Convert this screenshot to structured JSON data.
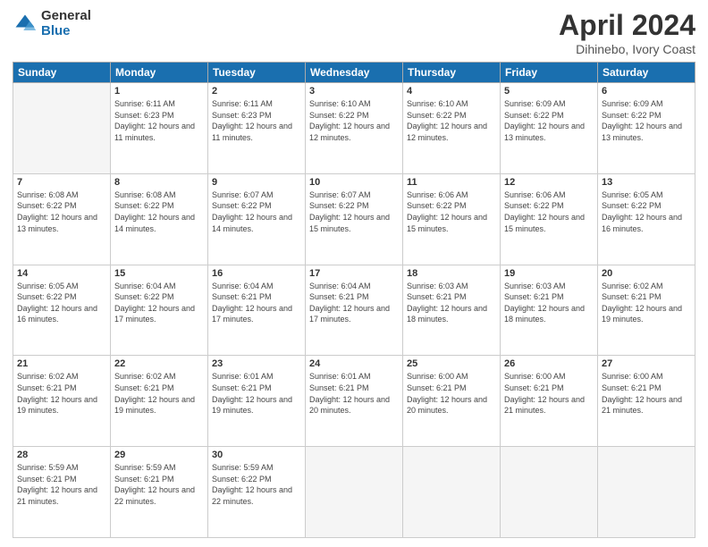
{
  "header": {
    "logo_general": "General",
    "logo_blue": "Blue",
    "title": "April 2024",
    "location": "Dihinebo, Ivory Coast"
  },
  "weekdays": [
    "Sunday",
    "Monday",
    "Tuesday",
    "Wednesday",
    "Thursday",
    "Friday",
    "Saturday"
  ],
  "weeks": [
    [
      {
        "day": "",
        "sunrise": "",
        "sunset": "",
        "daylight": "",
        "empty": true
      },
      {
        "day": "1",
        "sunrise": "Sunrise: 6:11 AM",
        "sunset": "Sunset: 6:23 PM",
        "daylight": "Daylight: 12 hours and 11 minutes."
      },
      {
        "day": "2",
        "sunrise": "Sunrise: 6:11 AM",
        "sunset": "Sunset: 6:23 PM",
        "daylight": "Daylight: 12 hours and 11 minutes."
      },
      {
        "day": "3",
        "sunrise": "Sunrise: 6:10 AM",
        "sunset": "Sunset: 6:22 PM",
        "daylight": "Daylight: 12 hours and 12 minutes."
      },
      {
        "day": "4",
        "sunrise": "Sunrise: 6:10 AM",
        "sunset": "Sunset: 6:22 PM",
        "daylight": "Daylight: 12 hours and 12 minutes."
      },
      {
        "day": "5",
        "sunrise": "Sunrise: 6:09 AM",
        "sunset": "Sunset: 6:22 PM",
        "daylight": "Daylight: 12 hours and 13 minutes."
      },
      {
        "day": "6",
        "sunrise": "Sunrise: 6:09 AM",
        "sunset": "Sunset: 6:22 PM",
        "daylight": "Daylight: 12 hours and 13 minutes."
      }
    ],
    [
      {
        "day": "7",
        "sunrise": "Sunrise: 6:08 AM",
        "sunset": "Sunset: 6:22 PM",
        "daylight": "Daylight: 12 hours and 13 minutes."
      },
      {
        "day": "8",
        "sunrise": "Sunrise: 6:08 AM",
        "sunset": "Sunset: 6:22 PM",
        "daylight": "Daylight: 12 hours and 14 minutes."
      },
      {
        "day": "9",
        "sunrise": "Sunrise: 6:07 AM",
        "sunset": "Sunset: 6:22 PM",
        "daylight": "Daylight: 12 hours and 14 minutes."
      },
      {
        "day": "10",
        "sunrise": "Sunrise: 6:07 AM",
        "sunset": "Sunset: 6:22 PM",
        "daylight": "Daylight: 12 hours and 15 minutes."
      },
      {
        "day": "11",
        "sunrise": "Sunrise: 6:06 AM",
        "sunset": "Sunset: 6:22 PM",
        "daylight": "Daylight: 12 hours and 15 minutes."
      },
      {
        "day": "12",
        "sunrise": "Sunrise: 6:06 AM",
        "sunset": "Sunset: 6:22 PM",
        "daylight": "Daylight: 12 hours and 15 minutes."
      },
      {
        "day": "13",
        "sunrise": "Sunrise: 6:05 AM",
        "sunset": "Sunset: 6:22 PM",
        "daylight": "Daylight: 12 hours and 16 minutes."
      }
    ],
    [
      {
        "day": "14",
        "sunrise": "Sunrise: 6:05 AM",
        "sunset": "Sunset: 6:22 PM",
        "daylight": "Daylight: 12 hours and 16 minutes."
      },
      {
        "day": "15",
        "sunrise": "Sunrise: 6:04 AM",
        "sunset": "Sunset: 6:22 PM",
        "daylight": "Daylight: 12 hours and 17 minutes."
      },
      {
        "day": "16",
        "sunrise": "Sunrise: 6:04 AM",
        "sunset": "Sunset: 6:21 PM",
        "daylight": "Daylight: 12 hours and 17 minutes."
      },
      {
        "day": "17",
        "sunrise": "Sunrise: 6:04 AM",
        "sunset": "Sunset: 6:21 PM",
        "daylight": "Daylight: 12 hours and 17 minutes."
      },
      {
        "day": "18",
        "sunrise": "Sunrise: 6:03 AM",
        "sunset": "Sunset: 6:21 PM",
        "daylight": "Daylight: 12 hours and 18 minutes."
      },
      {
        "day": "19",
        "sunrise": "Sunrise: 6:03 AM",
        "sunset": "Sunset: 6:21 PM",
        "daylight": "Daylight: 12 hours and 18 minutes."
      },
      {
        "day": "20",
        "sunrise": "Sunrise: 6:02 AM",
        "sunset": "Sunset: 6:21 PM",
        "daylight": "Daylight: 12 hours and 19 minutes."
      }
    ],
    [
      {
        "day": "21",
        "sunrise": "Sunrise: 6:02 AM",
        "sunset": "Sunset: 6:21 PM",
        "daylight": "Daylight: 12 hours and 19 minutes."
      },
      {
        "day": "22",
        "sunrise": "Sunrise: 6:02 AM",
        "sunset": "Sunset: 6:21 PM",
        "daylight": "Daylight: 12 hours and 19 minutes."
      },
      {
        "day": "23",
        "sunrise": "Sunrise: 6:01 AM",
        "sunset": "Sunset: 6:21 PM",
        "daylight": "Daylight: 12 hours and 19 minutes."
      },
      {
        "day": "24",
        "sunrise": "Sunrise: 6:01 AM",
        "sunset": "Sunset: 6:21 PM",
        "daylight": "Daylight: 12 hours and 20 minutes."
      },
      {
        "day": "25",
        "sunrise": "Sunrise: 6:00 AM",
        "sunset": "Sunset: 6:21 PM",
        "daylight": "Daylight: 12 hours and 20 minutes."
      },
      {
        "day": "26",
        "sunrise": "Sunrise: 6:00 AM",
        "sunset": "Sunset: 6:21 PM",
        "daylight": "Daylight: 12 hours and 21 minutes."
      },
      {
        "day": "27",
        "sunrise": "Sunrise: 6:00 AM",
        "sunset": "Sunset: 6:21 PM",
        "daylight": "Daylight: 12 hours and 21 minutes."
      }
    ],
    [
      {
        "day": "28",
        "sunrise": "Sunrise: 5:59 AM",
        "sunset": "Sunset: 6:21 PM",
        "daylight": "Daylight: 12 hours and 21 minutes."
      },
      {
        "day": "29",
        "sunrise": "Sunrise: 5:59 AM",
        "sunset": "Sunset: 6:21 PM",
        "daylight": "Daylight: 12 hours and 22 minutes."
      },
      {
        "day": "30",
        "sunrise": "Sunrise: 5:59 AM",
        "sunset": "Sunset: 6:22 PM",
        "daylight": "Daylight: 12 hours and 22 minutes."
      },
      {
        "day": "",
        "sunrise": "",
        "sunset": "",
        "daylight": "",
        "empty": true
      },
      {
        "day": "",
        "sunrise": "",
        "sunset": "",
        "daylight": "",
        "empty": true
      },
      {
        "day": "",
        "sunrise": "",
        "sunset": "",
        "daylight": "",
        "empty": true
      },
      {
        "day": "",
        "sunrise": "",
        "sunset": "",
        "daylight": "",
        "empty": true
      }
    ]
  ]
}
